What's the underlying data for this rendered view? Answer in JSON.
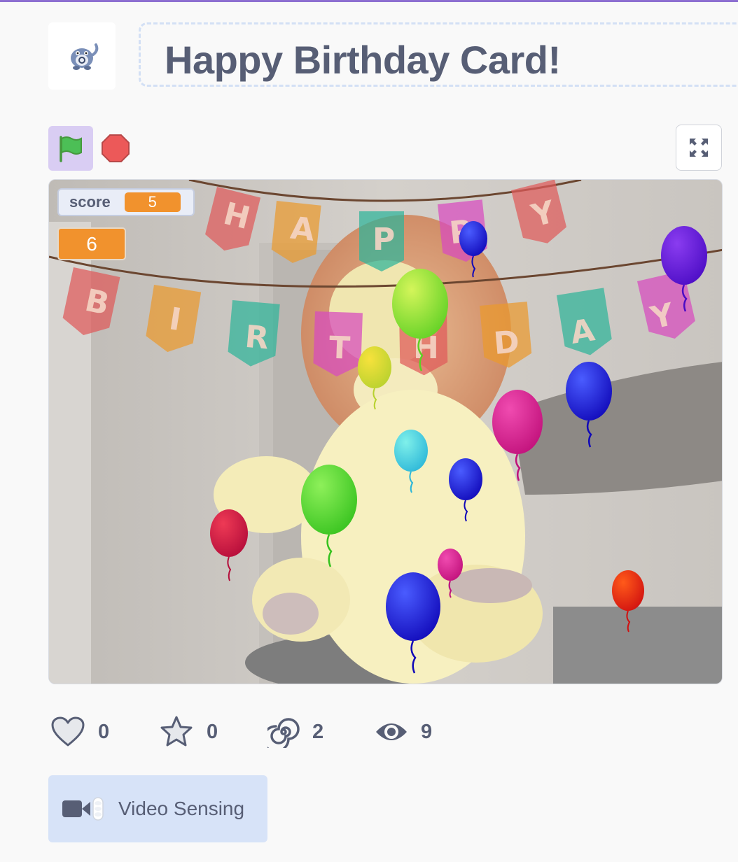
{
  "project": {
    "title": "Happy Birthday Card!"
  },
  "controls": {
    "green_flag_icon": "green-flag-icon",
    "stop_icon": "stop-sign-icon",
    "fullscreen_icon": "fullscreen-icon"
  },
  "stage": {
    "banner_top_letters": [
      "H",
      "A",
      "P",
      "P",
      "Y"
    ],
    "banner_bottom_letters": [
      "B",
      "I",
      "R",
      "T",
      "H",
      "D",
      "A",
      "Y"
    ],
    "monitor_score_label": "score",
    "monitor_score_value": "5",
    "monitor_large_value": "6"
  },
  "stats": {
    "loves": "0",
    "favorites": "0",
    "remixes": "2",
    "views": "9"
  },
  "extension": {
    "label": "Video Sensing"
  },
  "colors": {
    "accent": "#8d6fd1",
    "text": "#575e75",
    "monitor": "#f1922d",
    "extension_bg": "#d7e3f8"
  }
}
